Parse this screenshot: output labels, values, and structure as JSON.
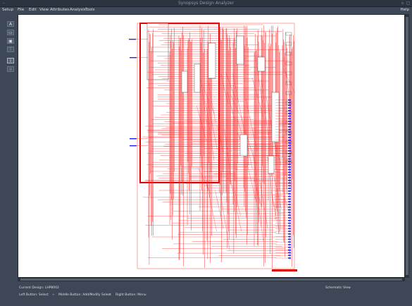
{
  "window": {
    "title": "Synopsys Design Analyzer"
  },
  "menu": [
    "Setup",
    "File",
    "Edit",
    "View",
    "Attributes",
    "Analysis",
    "Tools"
  ],
  "menu_help": "Help",
  "toolbar": [
    {
      "name": "add-icon",
      "glyph": "A"
    },
    {
      "name": "view-icon",
      "glyph": "▭"
    },
    {
      "name": "chip-icon",
      "glyph": "▣"
    },
    {
      "name": "text-icon",
      "glyph": "T"
    },
    {
      "name": "info-icon",
      "glyph": "i"
    },
    {
      "name": "zoom-icon",
      "glyph": "⊕"
    }
  ],
  "status": {
    "current_design": "Current Design: LHP8002",
    "view_mode": "Schematic View",
    "left_hint": "Left Button: Select",
    "middle_hint": "Middle Button: Add/Modify Select",
    "right_hint": "Right Button: Menu"
  },
  "colors": {
    "wire": "#ff2020",
    "port": "#2020ff",
    "frame": "#dd0000"
  }
}
